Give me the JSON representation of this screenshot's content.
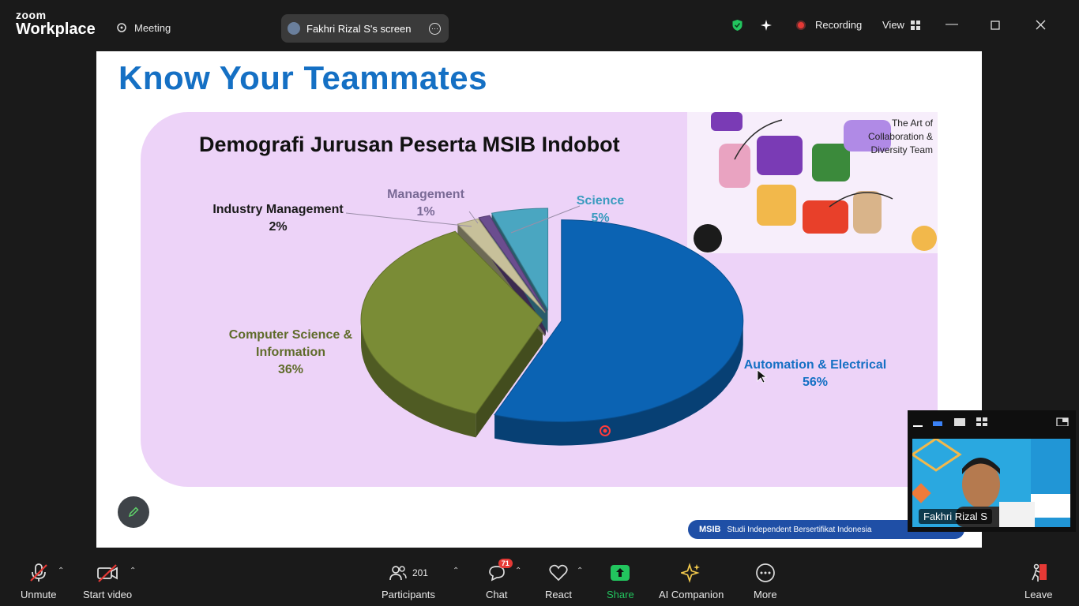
{
  "app": {
    "logo_line1": "zoom",
    "logo_line2": "Workplace"
  },
  "topbar": {
    "meeting_label": "Meeting",
    "screen_share_label": "Fakhri Rizal S's screen",
    "recording_label": "Recording",
    "view_label": "View"
  },
  "slide": {
    "title": "Know Your Teammates",
    "chart_title": "Demografi Jurusan Peserta MSIB Indobot",
    "art_caption": "The Art of Collaboration & Diversity Team",
    "footer_brand": "MSIB",
    "footer_text": "Studi Independent Bersertifikat Indonesia"
  },
  "chart_data": {
    "type": "pie",
    "title": "Demografi Jurusan Peserta MSIB Indobot",
    "slices": [
      {
        "label": "Automation & Electrical",
        "value": 56,
        "value_label": "56%",
        "color": "#0b63b3"
      },
      {
        "label": "Computer Science & Information",
        "value": 36,
        "value_label": "36%",
        "color": "#7a8c36"
      },
      {
        "label": "Industry Management",
        "value": 2,
        "value_label": "2%",
        "color": "#c7c09a"
      },
      {
        "label": "Management",
        "value": 1,
        "value_label": "1%",
        "color": "#6b4d8f"
      },
      {
        "label": "Science",
        "value": 5,
        "value_label": "5%",
        "color": "#4aa6c1"
      }
    ]
  },
  "labels": {
    "automation_name": "Automation & Electrical",
    "automation_pct": "56%",
    "cs_name_1": "Computer Science &",
    "cs_name_2": "Information",
    "cs_pct": "36%",
    "industry_name": "Industry Management",
    "industry_pct": "2%",
    "management_name": "Management",
    "management_pct": "1%",
    "science_name": "Science",
    "science_pct": "5%"
  },
  "video": {
    "participant_name": "Fakhri Rizal S"
  },
  "toolbar": {
    "unmute": "Unmute",
    "start_video": "Start video",
    "participants": "Participants",
    "participants_count": "201",
    "chat": "Chat",
    "chat_badge": "71",
    "react": "React",
    "share": "Share",
    "ai_companion": "AI Companion",
    "more": "More",
    "leave": "Leave"
  },
  "colors": {
    "title_blue": "#1570c4",
    "panel_lilac": "#edd3f8",
    "share_green": "#22c55e",
    "leave_red": "#e53935"
  }
}
